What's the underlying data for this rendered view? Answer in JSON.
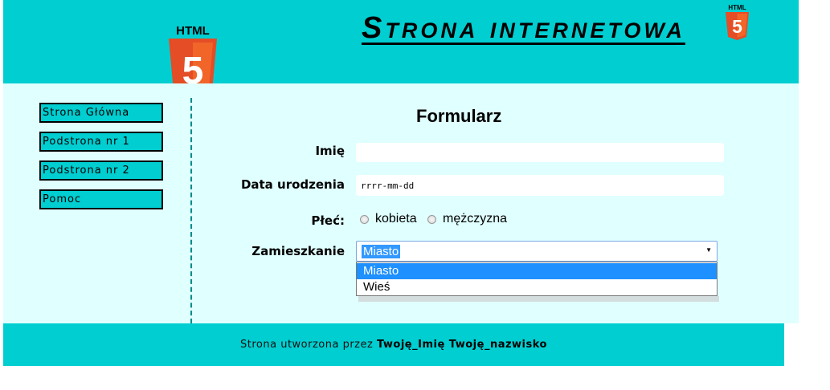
{
  "header": {
    "title": "Strona internetowa",
    "logo_text": "HTML",
    "logo_number": "5"
  },
  "nav": {
    "items": [
      {
        "label": "Strona Główna"
      },
      {
        "label": "Podstrona nr 1"
      },
      {
        "label": "Podstrona nr 2"
      },
      {
        "label": "Pomoc"
      }
    ]
  },
  "form": {
    "title": "Formularz",
    "name_label": "Imię",
    "name_value": "",
    "birth_label": "Data urodzenia",
    "birth_placeholder": "rrrr-mm-dd",
    "gender_label": "Płeć:",
    "gender_options": [
      "kobieta",
      "mężczyzna"
    ],
    "residence_label": "Zamieszkanie",
    "residence_selected": "Miasto",
    "residence_options": [
      "Miasto",
      "Wieś"
    ]
  },
  "footer": {
    "prefix": "Strona utworzona przez ",
    "author": "Twoję_Imię Twoję_nazwisko"
  },
  "colors": {
    "header_bg": "#00ced1",
    "content_bg": "#e0ffff",
    "selection": "#1e90ff",
    "html5_orange": "#e44d26"
  }
}
